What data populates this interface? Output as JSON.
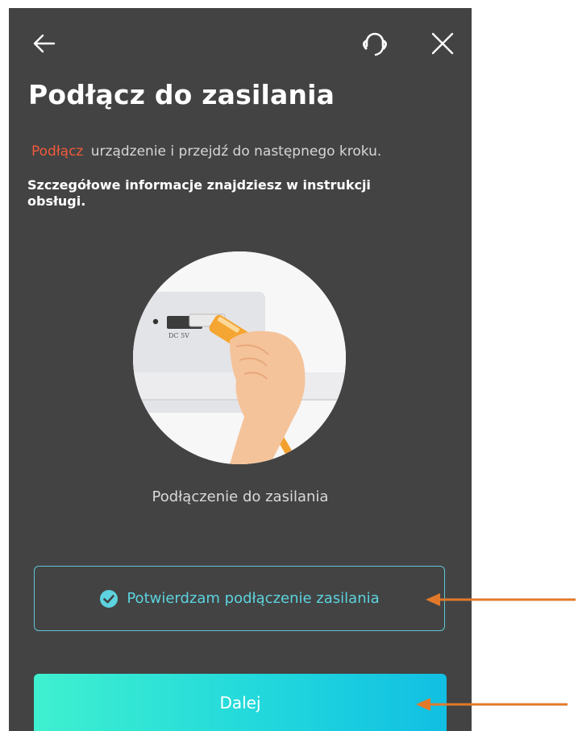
{
  "header": {
    "back_icon": "arrow-left-icon",
    "support_icon": "headset-icon",
    "close_icon": "close-icon"
  },
  "title": "Podłącz do zasilania",
  "instruction": {
    "highlight": "Podłącz",
    "rest": "urządzenie i przejdź do następnego kroku."
  },
  "detail": "Szczegółowe informacje znajdziesz w instrukcji obsługi.",
  "illustration": {
    "port_label": "DC 5V"
  },
  "caption": "Podłączenie do zasilania",
  "confirm": {
    "label": "Potwierdzam podłączenie zasilania",
    "checked": true,
    "icon": "check-circle-icon"
  },
  "next_button": {
    "label": "Dalej"
  },
  "colors": {
    "background": "#434343",
    "accent_red": "#ef5a3c",
    "accent_cyan": "#5cd3df",
    "button_gradient_start": "#3ff0cf",
    "button_gradient_end": "#11bfe3",
    "annotation_arrow": "#e2792a"
  }
}
